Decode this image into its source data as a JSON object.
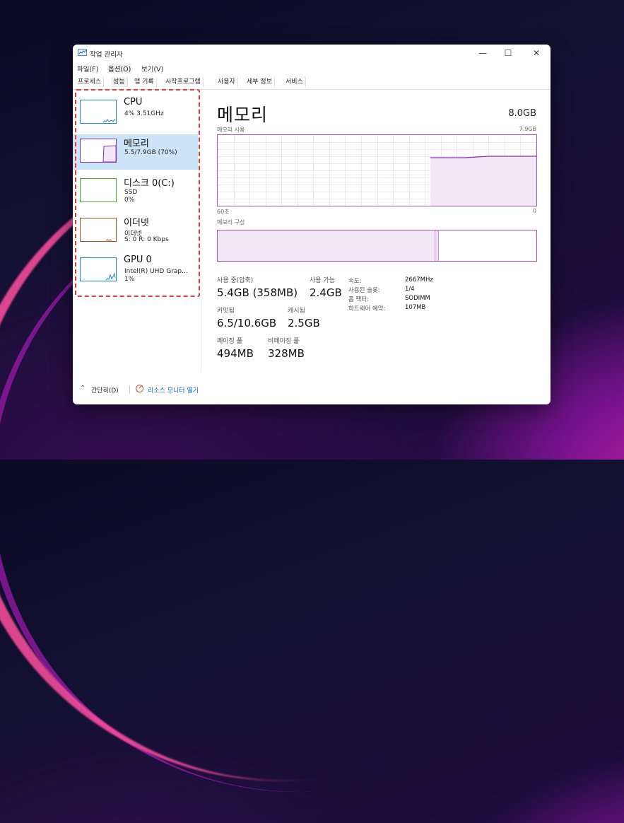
{
  "window": {
    "title": "작업 관리자",
    "controls": {
      "minimize": "—",
      "maximize": "☐",
      "close": "✕"
    }
  },
  "menubar": [
    "파일(F)",
    "옵션(O)",
    "보기(V)"
  ],
  "tabs": [
    "프로세스",
    "성능",
    "앱 기록",
    "시작프로그램",
    "사용자",
    "세부 정보",
    "서비스"
  ],
  "active_tab": "성능",
  "sidebar": {
    "items": [
      {
        "title": "CPU",
        "lines": [
          "4% 3.51GHz"
        ],
        "color": "#1a8ccc"
      },
      {
        "title": "메모리",
        "lines": [
          "5.5/7.9GB (70%)"
        ],
        "color": "#8b2fb3",
        "selected": true
      },
      {
        "title": "디스크 0(C:)",
        "lines": [
          "SSD",
          "0%"
        ],
        "color": "#4caa2a"
      },
      {
        "title": "이더넷",
        "lines": [
          "이더넷",
          "S: 0  R: 0 Kbps"
        ],
        "color": "#a0522d"
      },
      {
        "title": "GPU 0",
        "lines": [
          "Intel(R) UHD Grap...",
          "1%"
        ],
        "color": "#1a8ccc"
      }
    ]
  },
  "main": {
    "title": "메모리",
    "total": "8.0GB",
    "usage_label": "메모리 사용",
    "usage_max": "7.9GB",
    "time_left": "60초",
    "time_right": "0",
    "composition_label": "메모리 구성",
    "usage_graph": {
      "values_pct": [
        0,
        0,
        0,
        0,
        0,
        0,
        0,
        0,
        0,
        0,
        0,
        0,
        0,
        0,
        0,
        0,
        0,
        0,
        68,
        68,
        68,
        68,
        69,
        70,
        70,
        70,
        70,
        70
      ]
    },
    "composition": {
      "in_use_fraction": 0.68,
      "modified_fraction": 0.01
    },
    "stats": {
      "in_use_label": "사용 중(압축)",
      "in_use_value": "5.4GB (358MB)",
      "available_label": "사용 가능",
      "available_value": "2.4GB",
      "committed_label": "커밋됨",
      "committed_value": "6.5/10.6GB",
      "cached_label": "캐시됨",
      "cached_value": "2.5GB",
      "paged_label": "페이징 풀",
      "paged_value": "494MB",
      "nonpaged_label": "비페이징 풀",
      "nonpaged_value": "328MB"
    },
    "properties": [
      {
        "label": "속도:",
        "value": "2667MHz"
      },
      {
        "label": "사용된 슬롯:",
        "value": "1/4"
      },
      {
        "label": "폼 팩터:",
        "value": "SODIMM"
      },
      {
        "label": "하드웨어 예약:",
        "value": "107MB"
      }
    ]
  },
  "footer": {
    "fewer_details": "간단히(D)",
    "resource_monitor": "리소스 모니터 열기",
    "link_color": "#0a66c2"
  }
}
